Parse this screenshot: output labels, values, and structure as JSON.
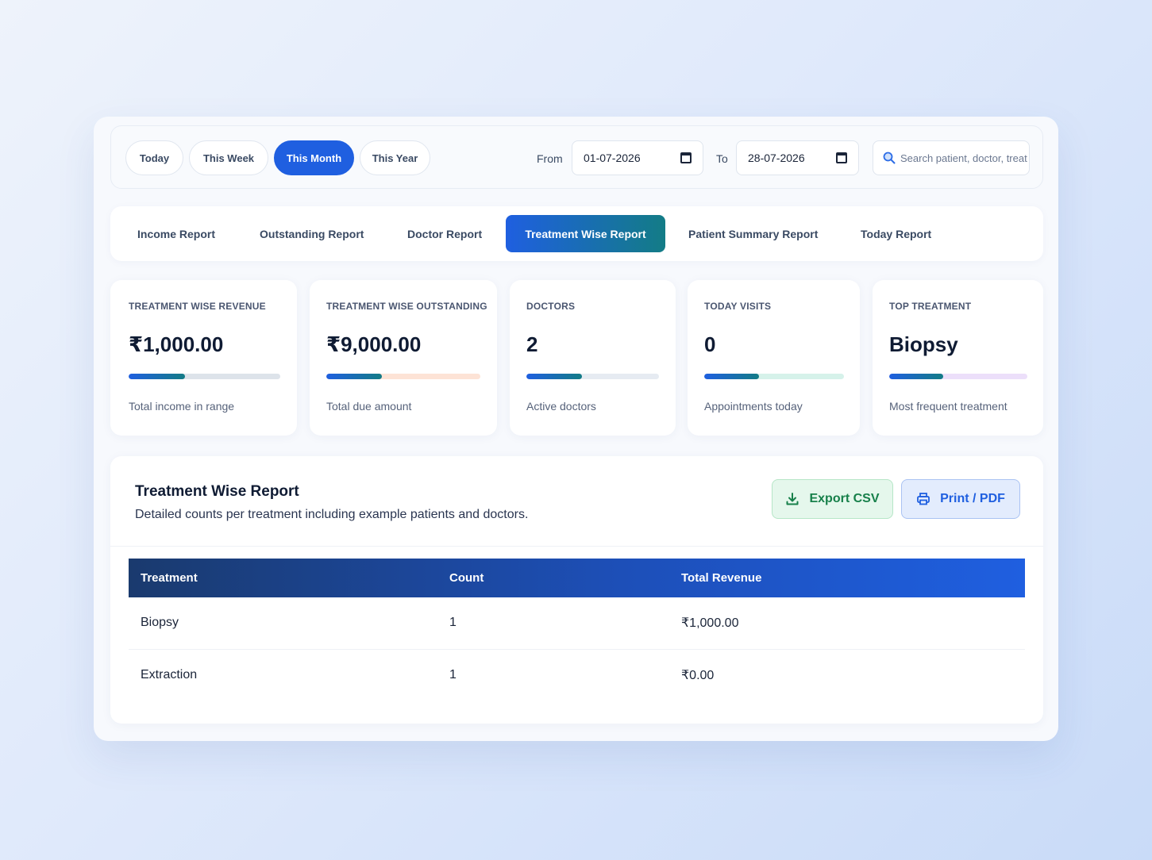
{
  "filters": {
    "ranges": [
      "Today",
      "This Week",
      "This Month",
      "This Year"
    ],
    "active_range": "This Month",
    "from_label": "From",
    "from_value": "01-07-2026",
    "to_label": "To",
    "to_value": "28-07-2026",
    "search_placeholder": "Search patient, doctor, treatment"
  },
  "tabs": [
    "Income Report",
    "Outstanding Report",
    "Doctor Report",
    "Treatment Wise Report",
    "Patient Summary Report",
    "Today Report"
  ],
  "active_tab": "Treatment Wise Report",
  "stats": [
    {
      "label": "TREATMENT WISE REVENUE",
      "value": "₹1,000.00",
      "desc": "Total income in range",
      "progress": 0.37,
      "track": "#dde3ea"
    },
    {
      "label": "TREATMENT WISE OUTSTANDING",
      "value": "₹9,000.00",
      "desc": "Total due amount",
      "progress": 0.36,
      "track": "#fde3d6"
    },
    {
      "label": "DOCTORS",
      "value": "2",
      "desc": "Active doctors",
      "progress": 0.42,
      "track": "#e6ebf2"
    },
    {
      "label": "TODAY VISITS",
      "value": "0",
      "desc": "Appointments today",
      "progress": 0.39,
      "track": "#d6f2ea"
    },
    {
      "label": "TOP TREATMENT",
      "value": "Biopsy",
      "desc": "Most frequent treatment",
      "progress": 0.39,
      "track": "#ecdffa"
    }
  ],
  "report": {
    "title": "Treatment Wise Report",
    "subtitle": "Detailed counts per treatment including example patients and doctors.",
    "export_csv": "Export CSV",
    "print_pdf": "Print / PDF",
    "columns": [
      "Treatment",
      "Count",
      "Total Revenue"
    ],
    "rows": [
      [
        "Biopsy",
        "1",
        "₹1,000.00"
      ],
      [
        "Extraction",
        "1",
        "₹0.00"
      ]
    ]
  },
  "colors": {
    "accent": "#1f5fe0",
    "accent_teal": "#137c86",
    "csv_green": "#17804a"
  }
}
